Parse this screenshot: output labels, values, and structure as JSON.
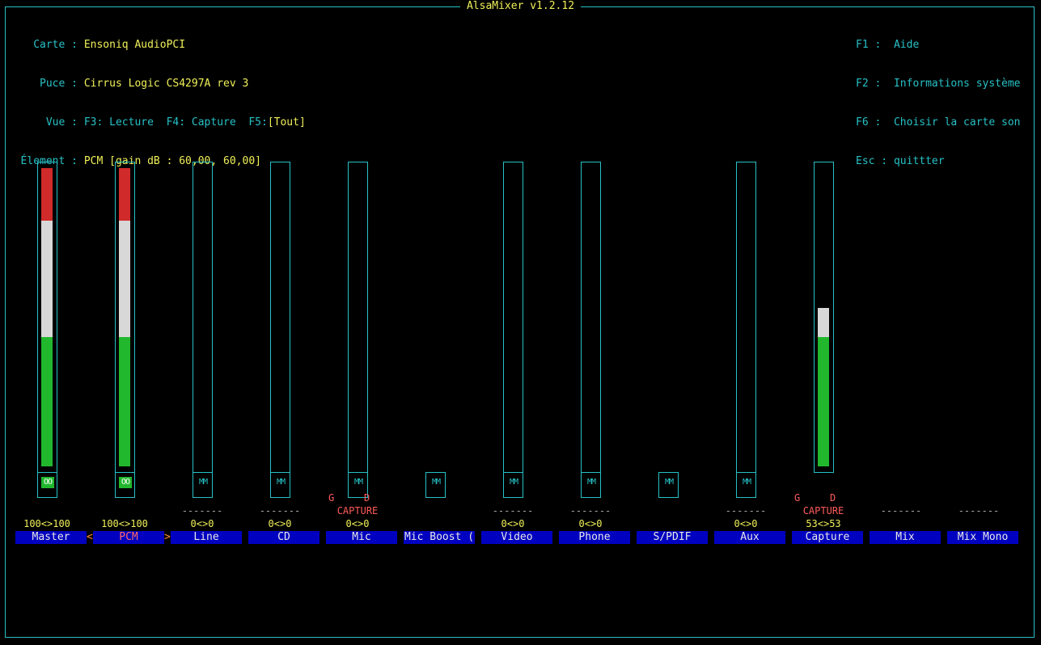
{
  "window": {
    "title": "AlsaMixer v1.2.12"
  },
  "info": {
    "card_label": "Carte :",
    "card_value": "Ensoniq AudioPCI",
    "chip_label": "Puce :",
    "chip_value": "Cirrus Logic CS4297A rev 3",
    "view_label": "Vue :",
    "view_f3": "F3: Lecture",
    "view_f4": "F4: Capture",
    "view_f5": "F5:",
    "view_current": "[Tout]",
    "item_label": "Élement :",
    "item_value": "PCM [gain dB : 60,00, 60,00]"
  },
  "help": {
    "f1": "F1 :  Aide",
    "f2": "F2 :  Informations système",
    "f6": "F6 :  Choisir la carte son",
    "esc": "Esc : quittter"
  },
  "controls": [
    {
      "name": "Master",
      "vol": "100<>100",
      "level": 1.0,
      "switch": "OO",
      "active": false
    },
    {
      "name": "PCM",
      "vol": "100<>100",
      "level": 1.0,
      "switch": "OO",
      "active": true
    },
    {
      "name": "Line",
      "vol": "0<>0",
      "level": 0,
      "switch": "MM",
      "dash": "-------"
    },
    {
      "name": "CD",
      "vol": "0<>0",
      "level": 0,
      "switch": "MM",
      "dash": "-------"
    },
    {
      "name": "Mic",
      "vol": "0<>0",
      "level": 0,
      "switch": "MM",
      "capture": "CAPTURE",
      "cap_l": "G",
      "cap_r": "D"
    },
    {
      "name": "Mic Boost (",
      "switch": "MM"
    },
    {
      "name": "Video",
      "vol": "0<>0",
      "level": 0,
      "switch": "MM",
      "dash": "-------"
    },
    {
      "name": "Phone",
      "vol": "0<>0",
      "level": 0,
      "switch": "MM",
      "dash": "-------"
    },
    {
      "name": "S/PDIF",
      "switch": "MM"
    },
    {
      "name": "Aux",
      "vol": "0<>0",
      "level": 0,
      "switch": "MM",
      "dash": "-------"
    },
    {
      "name": "Capture",
      "vol": "53<>53",
      "level": 0.53,
      "capture": "CAPTURE",
      "cap_l": "G",
      "cap_r": "D"
    },
    {
      "name": "Mix",
      "dash": "-------"
    },
    {
      "name": "Mix Mono",
      "dash": "-------"
    }
  ],
  "selection_markers": {
    "left": "<",
    "right": ">"
  }
}
